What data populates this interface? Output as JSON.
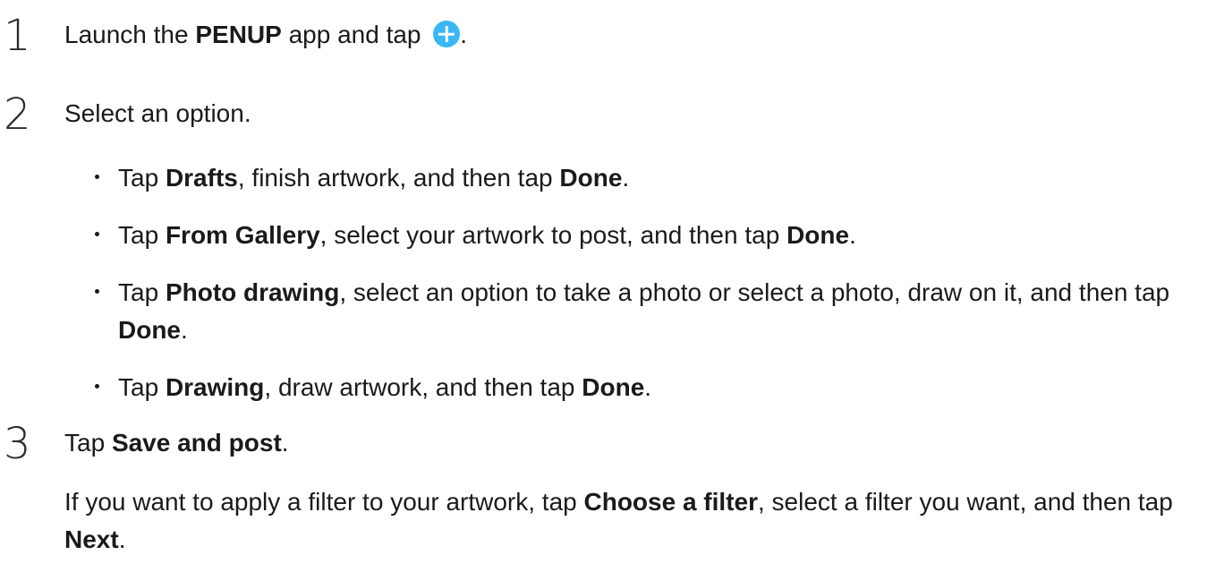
{
  "steps": [
    {
      "number": "1",
      "parts": [
        "Launch the ",
        "PENUP",
        " app and tap ",
        "."
      ]
    },
    {
      "number": "2",
      "text": "Select an option."
    },
    {
      "number": "3",
      "parts": [
        "Tap ",
        "Save and post",
        "."
      ]
    }
  ],
  "bullets": [
    [
      "Tap ",
      "Drafts",
      ", finish artwork, and then tap ",
      "Done",
      "."
    ],
    [
      "Tap ",
      "From Gallery",
      ", select your artwork to post, and then tap ",
      "Done",
      "."
    ],
    [
      "Tap ",
      "Photo drawing",
      ", select an option to take a photo or select a photo, draw on it, and then tap ",
      "Done",
      "."
    ],
    [
      "Tap ",
      "Drawing",
      ", draw artwork, and then tap ",
      "Done",
      "."
    ]
  ],
  "note": [
    "If you want to apply a filter to your artwork, tap ",
    "Choose a filter",
    ", select a filter you want, and then tap ",
    "Next",
    "."
  ],
  "icons": {
    "add": "plus-circle-icon",
    "add_color": "#39b7f5"
  }
}
